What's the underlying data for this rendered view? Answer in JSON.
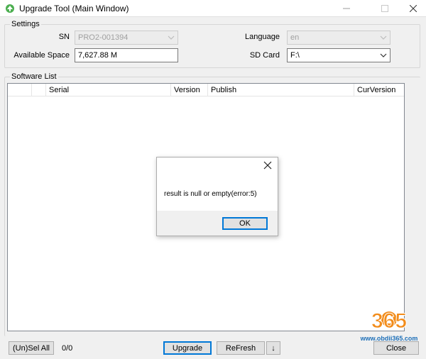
{
  "window": {
    "title": "Upgrade Tool (Main Window)",
    "icon": "app-icon",
    "minimize_icon": "minimize-icon",
    "maximize_icon": "maximize-icon",
    "close_icon": "close-icon"
  },
  "settings": {
    "group_label": "Settings",
    "sn_label": "SN",
    "sn_value": "PRO2-001394",
    "space_label": "Available Space",
    "space_value": "7,627.88 M",
    "language_label": "Language",
    "language_value": "en",
    "sdcard_label": "SD Card",
    "sdcard_value": "F:\\"
  },
  "software_list": {
    "group_label": "Software List",
    "columns": [
      "",
      "",
      "Serial",
      "Version",
      "Publish",
      "CurVersion"
    ]
  },
  "footer": {
    "unsel_all": "(Un)Sel All",
    "count": "0/0",
    "upgrade": "Upgrade",
    "refresh": "ReFresh",
    "down_arrow": "↓",
    "close": "Close"
  },
  "dialog": {
    "message": "result is null or empty(error:5)",
    "ok": "OK",
    "close_icon": "close-icon"
  },
  "watermark": {
    "number": "365",
    "url": "www.obdii365.com"
  },
  "colors": {
    "accent": "#0078d7",
    "watermark_orange": "#f28c1b",
    "watermark_blue": "#1d6fb8"
  }
}
